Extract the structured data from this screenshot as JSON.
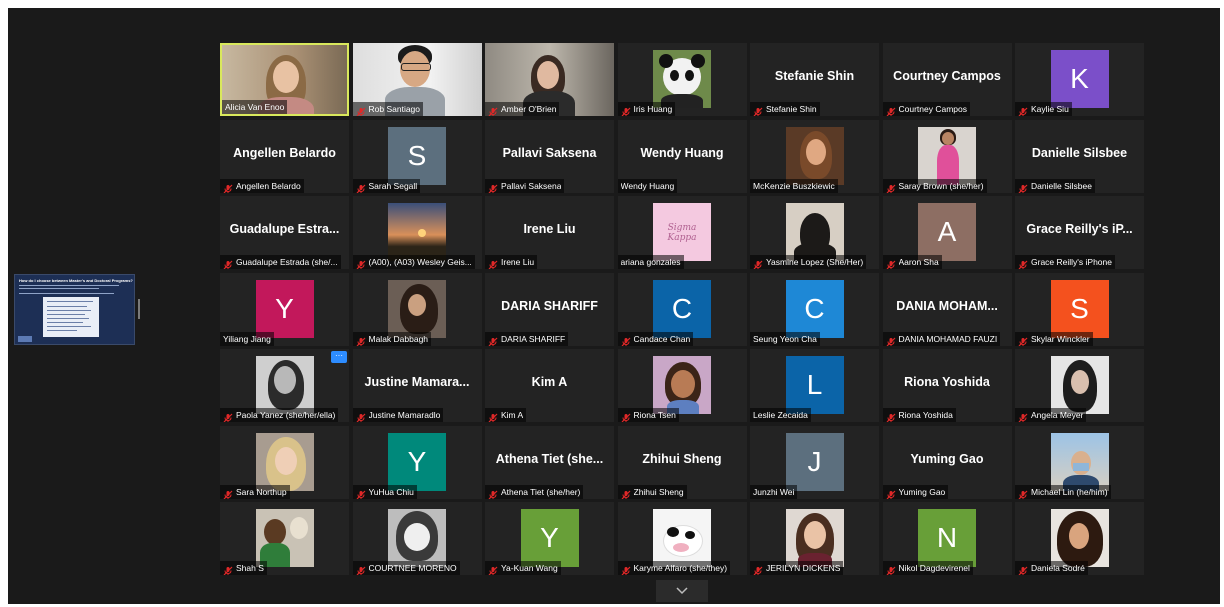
{
  "shared_screen": {
    "title": "How do I choose between Master's and Doctoral Programs?"
  },
  "colors": {
    "active_speaker_border": "#d9e85c",
    "mute_icon": "#e02828",
    "more_button": "#2d8cff"
  },
  "participants": [
    {
      "name": "Alicia Van Enoo",
      "type": "video",
      "muted": false,
      "active": true,
      "scene": "alicia"
    },
    {
      "name": "Rob Santiago",
      "type": "video",
      "muted": true,
      "scene": "rob"
    },
    {
      "name": "Amber O'Brien",
      "type": "video",
      "muted": true,
      "scene": "amber"
    },
    {
      "name": "Iris Huang",
      "type": "photo",
      "muted": true,
      "photo": "panda-icon"
    },
    {
      "name": "Stefanie Shin",
      "display": "Stefanie Shin",
      "type": "text",
      "muted": true
    },
    {
      "name": "Courtney Campos",
      "display": "Courtney Campos",
      "type": "text",
      "muted": true
    },
    {
      "name": "Kaylie Siu",
      "type": "initial",
      "initial": "K",
      "color": "#7b4fc9",
      "muted": true
    },
    {
      "name": "Angellen Belardo",
      "display": "Angellen Belardo",
      "type": "text",
      "muted": true
    },
    {
      "name": "Sarah Segall",
      "type": "initial",
      "initial": "S",
      "color": "#5c6f7e",
      "muted": true
    },
    {
      "name": "Pallavi Saksena",
      "display": "Pallavi Saksena",
      "type": "text",
      "muted": true
    },
    {
      "name": "Wendy Huang",
      "display": "Wendy Huang",
      "type": "text",
      "muted": false
    },
    {
      "name": "McKenzie Buszkiewic",
      "type": "photo",
      "muted": false,
      "photo": "portrait-warm"
    },
    {
      "name": "Saray Brown (she/her)",
      "type": "photo",
      "muted": true,
      "photo": "portrait-pink"
    },
    {
      "name": "Danielle Silsbee",
      "display": "Danielle Silsbee",
      "type": "text",
      "muted": true
    },
    {
      "name": "Guadalupe Estrada (she/...",
      "display": "Guadalupe Estra...",
      "type": "text",
      "muted": true
    },
    {
      "name": "(A00), (A03) Wesley Geis...",
      "type": "photo",
      "muted": true,
      "photo": "sunset"
    },
    {
      "name": "Irene Liu",
      "display": "Irene Liu",
      "type": "text",
      "muted": true
    },
    {
      "name": "ariana gonzales",
      "type": "photo",
      "muted": false,
      "photo": "sigma-kappa-logo"
    },
    {
      "name": "Yasmine Lopez (She/Her)",
      "type": "photo",
      "muted": true,
      "photo": "silhouette"
    },
    {
      "name": "Aaron Sha",
      "type": "initial",
      "initial": "A",
      "color": "#8d6e63",
      "muted": true
    },
    {
      "name": "Grace Reilly's iPhone",
      "display": "Grace Reilly's iP...",
      "type": "text",
      "muted": true
    },
    {
      "name": "Yiliang Jiang",
      "type": "initial",
      "initial": "Y",
      "color": "#c2185b",
      "muted": false
    },
    {
      "name": "Malak Dabbagh",
      "type": "photo",
      "muted": true,
      "photo": "portrait-dark"
    },
    {
      "name": "DARIA SHARIFF",
      "display": "DARIA SHARIFF",
      "type": "text",
      "muted": true
    },
    {
      "name": "Candace Chan",
      "type": "initial",
      "initial": "C",
      "color": "#0b64a8",
      "muted": true
    },
    {
      "name": "Seung Yeon Cha",
      "type": "initial",
      "initial": "C",
      "color": "#1e88d6",
      "muted": false
    },
    {
      "name": "DANIA MOHAMAD FAUZI",
      "display": "DANIA MOHAM...",
      "type": "text",
      "muted": true
    },
    {
      "name": "Skylar Winckler",
      "type": "initial",
      "initial": "S",
      "color": "#f4511e",
      "muted": true
    },
    {
      "name": "Paola Yanez (she/her/ella)",
      "type": "photo",
      "muted": true,
      "photo": "portrait-bw",
      "more": true,
      "more_label": "···"
    },
    {
      "name": "Justine Mamaradlo",
      "display": "Justine Mamara...",
      "type": "text",
      "muted": true
    },
    {
      "name": "Kim A",
      "display": "Kim A",
      "type": "text",
      "muted": true
    },
    {
      "name": "Riona Tsen",
      "type": "photo",
      "muted": true,
      "photo": "illustration"
    },
    {
      "name": "Leslie Zecaida",
      "type": "initial",
      "initial": "L",
      "color": "#0b64a8",
      "muted": false
    },
    {
      "name": "Riona Yoshida",
      "display": "Riona Yoshida",
      "type": "text",
      "muted": true
    },
    {
      "name": "Angela Meyer",
      "type": "photo",
      "muted": true,
      "photo": "portrait-light"
    },
    {
      "name": "Sara Northup",
      "type": "photo",
      "muted": true,
      "photo": "portrait-blonde"
    },
    {
      "name": "YuHua Chiu",
      "type": "initial",
      "initial": "Y",
      "color": "#00897b",
      "muted": true
    },
    {
      "name": "Athena Tiet (she/her)",
      "display": "Athena Tiet (she...",
      "type": "text",
      "muted": true
    },
    {
      "name": "Zhihui Sheng",
      "display": "Zhihui Sheng",
      "type": "text",
      "muted": true
    },
    {
      "name": "Junzhi Wei",
      "type": "initial",
      "initial": "J",
      "color": "#5c6f7e",
      "muted": false
    },
    {
      "name": "Yuming Gao",
      "display": "Yuming Gao",
      "type": "text",
      "muted": true
    },
    {
      "name": "Michael Lin (he/him)",
      "type": "photo",
      "muted": true,
      "photo": "portrait-outdoor"
    },
    {
      "name": "Shah S",
      "type": "photo",
      "muted": true,
      "photo": "portrait-cartoon"
    },
    {
      "name": "COURTNEE MORENO",
      "type": "photo",
      "muted": true,
      "photo": "anime"
    },
    {
      "name": "Ya-Kuan Wang",
      "type": "initial",
      "initial": "Y",
      "color": "#689f38",
      "muted": true
    },
    {
      "name": "Karyme Alfaro (she/they)",
      "type": "photo",
      "muted": true,
      "photo": "plush-cow"
    },
    {
      "name": "JERILYN DICKENS",
      "type": "photo",
      "muted": true,
      "photo": "portrait-smile"
    },
    {
      "name": "Nikol Dagdevirenel",
      "type": "initial",
      "initial": "N",
      "color": "#689f38",
      "muted": true
    },
    {
      "name": "Daniela Sodré",
      "type": "photo",
      "muted": true,
      "photo": "portrait-curly"
    }
  ]
}
